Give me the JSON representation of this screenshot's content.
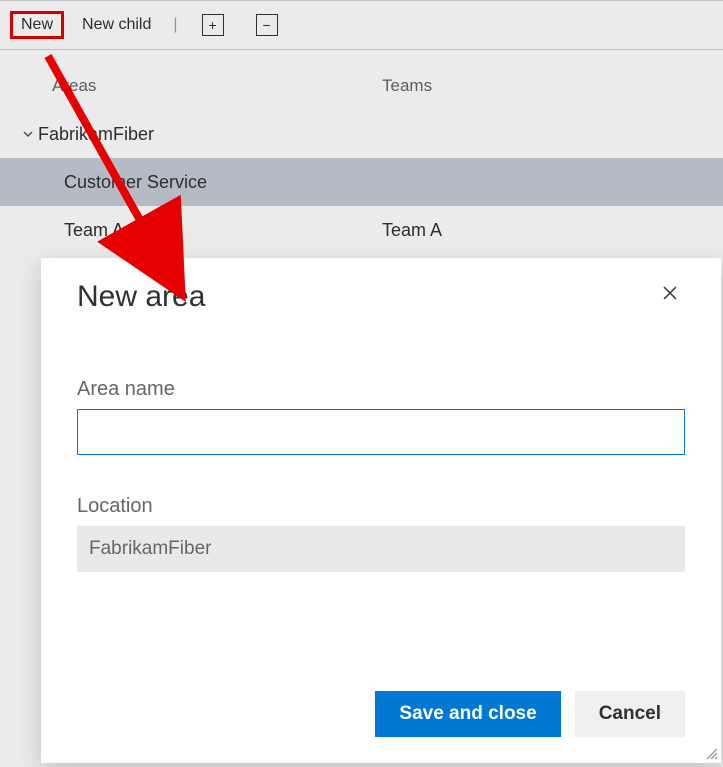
{
  "toolbar": {
    "new_label": "New",
    "new_child_label": "New child",
    "expand_glyph": "+",
    "collapse_glyph": "−"
  },
  "tree": {
    "headers": {
      "areas": "Areas",
      "teams": "Teams"
    },
    "rows": [
      {
        "label": "FabrikamFiber",
        "team": "",
        "level": 0,
        "expanded": true
      },
      {
        "label": "Customer Service",
        "team": "",
        "level": 1,
        "selected": true
      },
      {
        "label": "Team A",
        "team": "Team A",
        "level": 1
      }
    ]
  },
  "dialog": {
    "title": "New area",
    "area_name_label": "Area name",
    "area_name_value": "",
    "location_label": "Location",
    "location_value": "FabrikamFiber",
    "save_label": "Save and close",
    "cancel_label": "Cancel"
  },
  "annotation": {
    "arrow_color": "#e60000"
  }
}
